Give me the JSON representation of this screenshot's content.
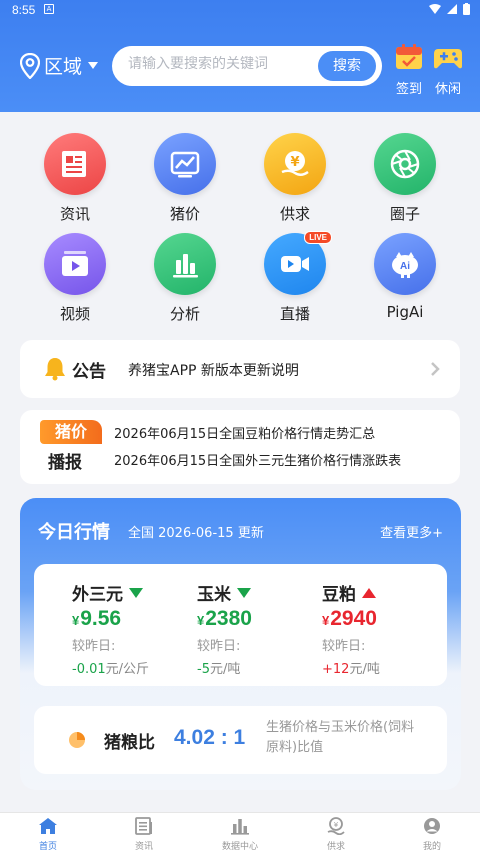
{
  "status_bar": {
    "time": "8:55",
    "notif_letter": "A"
  },
  "header": {
    "region_label": "区域",
    "search_placeholder": "请输入要搜索的关键词",
    "search_button": "搜索",
    "signin_label": "签到",
    "leisure_label": "休闲"
  },
  "menu": [
    {
      "label": "资讯",
      "icon": "news-icon",
      "color": "#f25a5a"
    },
    {
      "label": "猪价",
      "icon": "chart-icon",
      "color": "#4d7ff2"
    },
    {
      "label": "供求",
      "icon": "yuan-icon",
      "color": "#f7b41d"
    },
    {
      "label": "圈子",
      "icon": "aperture-icon",
      "color": "#2ec47a"
    },
    {
      "label": "视频",
      "icon": "video-icon",
      "color": "#8a6cf0"
    },
    {
      "label": "分析",
      "icon": "bar-chart-icon",
      "color": "#2ec47a"
    },
    {
      "label": "直播",
      "icon": "live-camera-icon",
      "color": "#2e93f2",
      "badge": "LIVE"
    },
    {
      "label": "PigAi",
      "icon": "piggy-ai-icon",
      "color": "#4d7ff2"
    }
  ],
  "notice": {
    "title": "公告",
    "text": "养猪宝APP 新版本更新说明"
  },
  "price_news": {
    "tag_top": "猪价",
    "tag_bottom": "播报",
    "items": [
      "2026年06月15日全国豆粕价格行情走势汇总",
      "2026年06月15日全国外三元生猪价格行情涨跌表"
    ]
  },
  "market": {
    "title": "今日行情",
    "subtitle": "全国 2026-06-15 更新",
    "more": "查看更多+",
    "items": [
      {
        "name": "外三元",
        "trend": "down",
        "currency": "¥",
        "value": "9.56",
        "compare_label": "较昨日:",
        "change": "-0.01",
        "unit": "元/公斤"
      },
      {
        "name": "玉米",
        "trend": "down",
        "currency": "¥",
        "value": "2380",
        "compare_label": "较昨日:",
        "change": "-5",
        "unit": "元/吨"
      },
      {
        "name": "豆粕",
        "trend": "up",
        "currency": "¥",
        "value": "2940",
        "compare_label": "较昨日:",
        "change": "+12",
        "unit": "元/吨"
      }
    ],
    "ratio": {
      "name": "猪粮比",
      "value": "4.02 : 1",
      "desc": "生猪价格与玉米价格(饲料原料)比值"
    }
  },
  "tabbar": [
    {
      "label": "首页",
      "icon": "home-icon",
      "active": true
    },
    {
      "label": "资讯",
      "icon": "news-icon",
      "active": false
    },
    {
      "label": "数据中心",
      "icon": "data-center-icon",
      "active": false
    },
    {
      "label": "供求",
      "icon": "supply-icon",
      "active": false
    },
    {
      "label": "我的",
      "icon": "profile-icon",
      "active": false
    }
  ],
  "colors": {
    "primary": "#4b8ef6",
    "down": "#1aa34a",
    "up": "#e8262f",
    "ratio": "#3d7fe0"
  }
}
